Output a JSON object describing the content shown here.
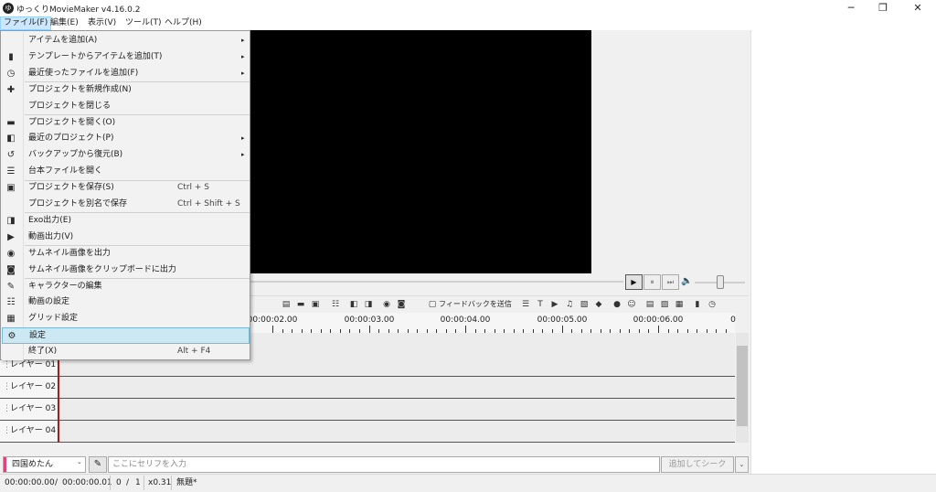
{
  "window": {
    "app_icon": "ゆ",
    "title": "ゆっくりMovieMaker v4.16.0.2",
    "minimize_icon": "─",
    "maximize_icon": "❐",
    "close_icon": "✕"
  },
  "menubar": {
    "items": [
      "ファイル(F)",
      "編集(E)",
      "表示(V)",
      "ツール(T)",
      "ヘルプ(H)"
    ]
  },
  "file_menu": {
    "items": [
      {
        "label": "アイテムを追加(A)",
        "shortcut": "",
        "submenu": true,
        "icon": ""
      },
      {
        "label": "テンプレートからアイテムを追加(T)",
        "shortcut": "",
        "submenu": true,
        "icon": "▮"
      },
      {
        "label": "最近使ったファイルを追加(F)",
        "shortcut": "",
        "submenu": true,
        "icon": "◷"
      },
      {
        "label": "プロジェクトを新規作成(N)",
        "shortcut": "",
        "submenu": false,
        "icon": "✚"
      },
      {
        "label": "プロジェクトを閉じる",
        "shortcut": "",
        "submenu": false,
        "icon": ""
      },
      {
        "label": "プロジェクトを開く(O)",
        "shortcut": "",
        "submenu": false,
        "icon": "▬"
      },
      {
        "label": "最近のプロジェクト(P)",
        "shortcut": "",
        "submenu": true,
        "icon": "◧"
      },
      {
        "label": "バックアップから復元(B)",
        "shortcut": "",
        "submenu": true,
        "icon": "↺"
      },
      {
        "label": "台本ファイルを開く",
        "shortcut": "",
        "submenu": false,
        "icon": "☰"
      },
      {
        "label": "プロジェクトを保存(S)",
        "shortcut": "Ctrl + S",
        "submenu": false,
        "icon": "▣"
      },
      {
        "label": "プロジェクトを別名で保存",
        "shortcut": "Ctrl + Shift + S",
        "submenu": false,
        "icon": ""
      },
      {
        "label": "Exo出力(E)",
        "shortcut": "",
        "submenu": false,
        "icon": "◨"
      },
      {
        "label": "動画出力(V)",
        "shortcut": "",
        "submenu": false,
        "icon": "▶"
      },
      {
        "label": "サムネイル画像を出力",
        "shortcut": "",
        "submenu": false,
        "icon": "◉"
      },
      {
        "label": "サムネイル画像をクリップボードに出力",
        "shortcut": "",
        "submenu": false,
        "icon": "◙"
      },
      {
        "label": "キャラクターの編集",
        "shortcut": "",
        "submenu": false,
        "icon": "✎"
      },
      {
        "label": "動画の設定",
        "shortcut": "",
        "submenu": false,
        "icon": "☷"
      },
      {
        "label": "グリッド設定",
        "shortcut": "",
        "submenu": false,
        "icon": "▦"
      },
      {
        "label": "設定",
        "shortcut": "",
        "submenu": false,
        "icon": "⚙",
        "highlighted": true
      },
      {
        "label": "終了(X)",
        "shortcut": "Alt + F4",
        "submenu": false,
        "icon": ""
      }
    ],
    "submenu_arrow": "▸"
  },
  "playback": {
    "play_icon": "▶",
    "pause_icon": "⏸",
    "next_icon": "⏭",
    "volume_icon": "🔈",
    "volume_level": 0.43
  },
  "toolbar": {
    "feedback_label": "フィードバックを送信"
  },
  "ruler": {
    "labels": [
      "00:00:02.00",
      "00:00:03.00",
      "00:00:04.00",
      "00:00:05.00",
      "00:00:06.00",
      "0"
    ]
  },
  "timeline": {
    "layers": [
      "レイヤー 01",
      "レイヤー 02",
      "レイヤー 03",
      "レイヤー 04"
    ],
    "grip": "⋮"
  },
  "bottom": {
    "character": "四国めたん",
    "character_color": "#e0457a",
    "dropdown_icon": "⌄",
    "edit_icon": "✎",
    "serif_placeholder": "ここにセリフを入力",
    "add_seek_label": "追加してシーク"
  },
  "status": {
    "current_time": "00:00:00.00",
    "slash": "/",
    "total_time": "00:00:00.01",
    "frame_current": "0",
    "frame_slash": "/",
    "frame_total": "1",
    "zoom": "x0.31",
    "project_name": "無題*"
  }
}
